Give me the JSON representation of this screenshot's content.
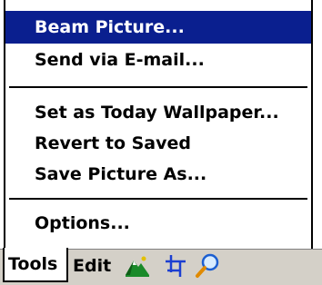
{
  "menu": {
    "items": [
      {
        "label": "Beam Picture..."
      },
      {
        "label": "Send via E-mail..."
      },
      {
        "label": "Set as Today Wallpaper..."
      },
      {
        "label": "Revert to Saved"
      },
      {
        "label": "Save Picture As..."
      },
      {
        "label": "Options..."
      }
    ],
    "selected_label": "Beam Picture..."
  },
  "taskbar": {
    "tools_label": "Tools",
    "edit_label": "Edit",
    "icons": [
      "mountain-picture-icon",
      "crop-icon",
      "zoom-icon"
    ]
  },
  "colors": {
    "selection": "#0a1f8f",
    "taskbar": "#d4d0c8"
  }
}
